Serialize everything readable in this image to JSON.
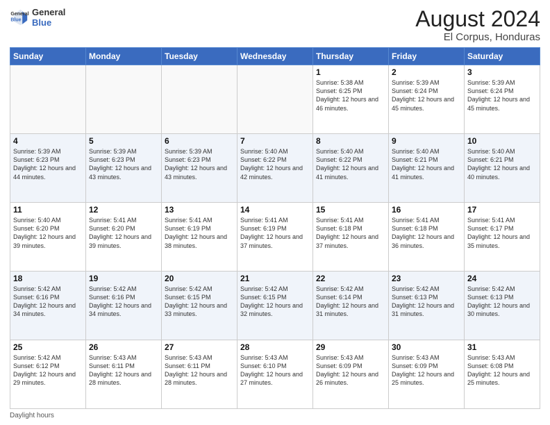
{
  "header": {
    "logo_line1": "General",
    "logo_line2": "Blue",
    "month_title": "August 2024",
    "location": "El Corpus, Honduras"
  },
  "days_of_week": [
    "Sunday",
    "Monday",
    "Tuesday",
    "Wednesday",
    "Thursday",
    "Friday",
    "Saturday"
  ],
  "footer": {
    "daylight_label": "Daylight hours"
  },
  "weeks": [
    [
      {
        "day": "",
        "empty": true
      },
      {
        "day": "",
        "empty": true
      },
      {
        "day": "",
        "empty": true
      },
      {
        "day": "",
        "empty": true
      },
      {
        "day": "1",
        "sunrise": "5:38 AM",
        "sunset": "6:25 PM",
        "daylight": "12 hours and 46 minutes."
      },
      {
        "day": "2",
        "sunrise": "5:39 AM",
        "sunset": "6:24 PM",
        "daylight": "12 hours and 45 minutes."
      },
      {
        "day": "3",
        "sunrise": "5:39 AM",
        "sunset": "6:24 PM",
        "daylight": "12 hours and 45 minutes."
      }
    ],
    [
      {
        "day": "4",
        "sunrise": "5:39 AM",
        "sunset": "6:23 PM",
        "daylight": "12 hours and 44 minutes."
      },
      {
        "day": "5",
        "sunrise": "5:39 AM",
        "sunset": "6:23 PM",
        "daylight": "12 hours and 43 minutes."
      },
      {
        "day": "6",
        "sunrise": "5:39 AM",
        "sunset": "6:23 PM",
        "daylight": "12 hours and 43 minutes."
      },
      {
        "day": "7",
        "sunrise": "5:40 AM",
        "sunset": "6:22 PM",
        "daylight": "12 hours and 42 minutes."
      },
      {
        "day": "8",
        "sunrise": "5:40 AM",
        "sunset": "6:22 PM",
        "daylight": "12 hours and 41 minutes."
      },
      {
        "day": "9",
        "sunrise": "5:40 AM",
        "sunset": "6:21 PM",
        "daylight": "12 hours and 41 minutes."
      },
      {
        "day": "10",
        "sunrise": "5:40 AM",
        "sunset": "6:21 PM",
        "daylight": "12 hours and 40 minutes."
      }
    ],
    [
      {
        "day": "11",
        "sunrise": "5:40 AM",
        "sunset": "6:20 PM",
        "daylight": "12 hours and 39 minutes."
      },
      {
        "day": "12",
        "sunrise": "5:41 AM",
        "sunset": "6:20 PM",
        "daylight": "12 hours and 39 minutes."
      },
      {
        "day": "13",
        "sunrise": "5:41 AM",
        "sunset": "6:19 PM",
        "daylight": "12 hours and 38 minutes."
      },
      {
        "day": "14",
        "sunrise": "5:41 AM",
        "sunset": "6:19 PM",
        "daylight": "12 hours and 37 minutes."
      },
      {
        "day": "15",
        "sunrise": "5:41 AM",
        "sunset": "6:18 PM",
        "daylight": "12 hours and 37 minutes."
      },
      {
        "day": "16",
        "sunrise": "5:41 AM",
        "sunset": "6:18 PM",
        "daylight": "12 hours and 36 minutes."
      },
      {
        "day": "17",
        "sunrise": "5:41 AM",
        "sunset": "6:17 PM",
        "daylight": "12 hours and 35 minutes."
      }
    ],
    [
      {
        "day": "18",
        "sunrise": "5:42 AM",
        "sunset": "6:16 PM",
        "daylight": "12 hours and 34 minutes."
      },
      {
        "day": "19",
        "sunrise": "5:42 AM",
        "sunset": "6:16 PM",
        "daylight": "12 hours and 34 minutes."
      },
      {
        "day": "20",
        "sunrise": "5:42 AM",
        "sunset": "6:15 PM",
        "daylight": "12 hours and 33 minutes."
      },
      {
        "day": "21",
        "sunrise": "5:42 AM",
        "sunset": "6:15 PM",
        "daylight": "12 hours and 32 minutes."
      },
      {
        "day": "22",
        "sunrise": "5:42 AM",
        "sunset": "6:14 PM",
        "daylight": "12 hours and 31 minutes."
      },
      {
        "day": "23",
        "sunrise": "5:42 AM",
        "sunset": "6:13 PM",
        "daylight": "12 hours and 31 minutes."
      },
      {
        "day": "24",
        "sunrise": "5:42 AM",
        "sunset": "6:13 PM",
        "daylight": "12 hours and 30 minutes."
      }
    ],
    [
      {
        "day": "25",
        "sunrise": "5:42 AM",
        "sunset": "6:12 PM",
        "daylight": "12 hours and 29 minutes."
      },
      {
        "day": "26",
        "sunrise": "5:43 AM",
        "sunset": "6:11 PM",
        "daylight": "12 hours and 28 minutes."
      },
      {
        "day": "27",
        "sunrise": "5:43 AM",
        "sunset": "6:11 PM",
        "daylight": "12 hours and 28 minutes."
      },
      {
        "day": "28",
        "sunrise": "5:43 AM",
        "sunset": "6:10 PM",
        "daylight": "12 hours and 27 minutes."
      },
      {
        "day": "29",
        "sunrise": "5:43 AM",
        "sunset": "6:09 PM",
        "daylight": "12 hours and 26 minutes."
      },
      {
        "day": "30",
        "sunrise": "5:43 AM",
        "sunset": "6:09 PM",
        "daylight": "12 hours and 25 minutes."
      },
      {
        "day": "31",
        "sunrise": "5:43 AM",
        "sunset": "6:08 PM",
        "daylight": "12 hours and 25 minutes."
      }
    ]
  ]
}
